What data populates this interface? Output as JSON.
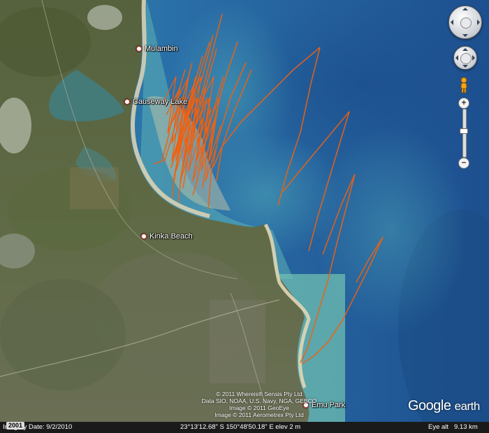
{
  "places": [
    {
      "name": "Mulambin"
    },
    {
      "name": "Causeway Lake"
    },
    {
      "name": "Kinka Beach"
    },
    {
      "name": "Emu Park"
    }
  ],
  "copyright": [
    "© 2011 Whereis® Sensis Pty Ltd",
    "Data SIO, NOAA, U.S. Navy, NGA, GEBCO",
    "Image © 2011 GeoEye",
    "Image © 2011 Aerometrex Pty Ltd"
  ],
  "logo": {
    "google": "Google",
    "earth": "earth"
  },
  "status": {
    "imagery_date": "Imagery Date: 9/2/2010",
    "year_badge": "2001",
    "coords": "23°13'12.68\" S  150°48'50.18\" E  elev   2 m",
    "eye_alt_label": "Eye alt",
    "eye_alt_value": "9.13 km"
  },
  "nav": {
    "zoom_in": "+",
    "zoom_out": "−"
  },
  "track_color": "#f06010",
  "sea_color": "#2a6fa8"
}
